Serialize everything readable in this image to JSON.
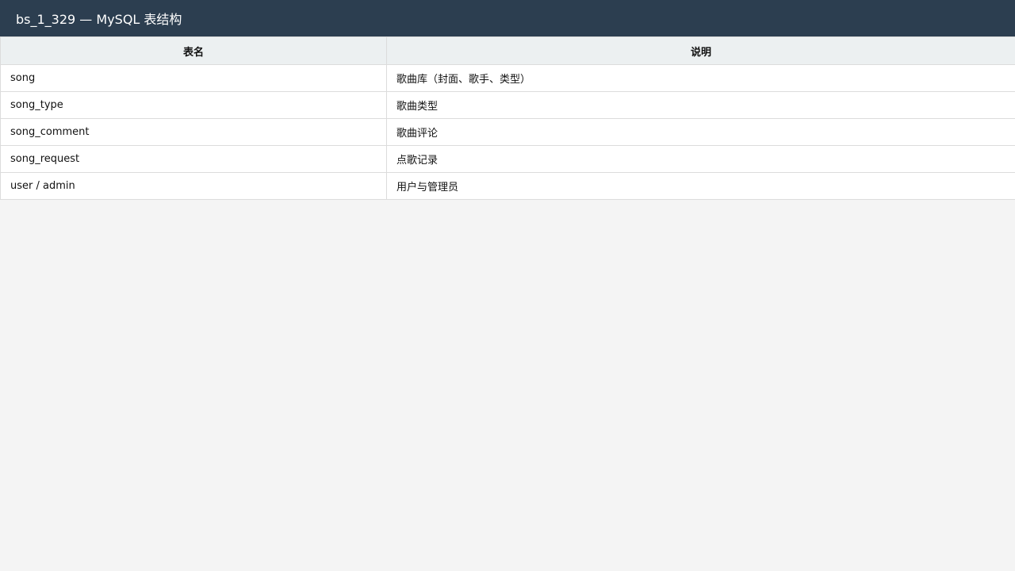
{
  "window": {
    "title": "bs_1_329 — MySQL 表结构"
  },
  "table": {
    "headers": [
      "表名",
      "说明"
    ],
    "rows": [
      [
        "song",
        "歌曲库（封面、歌手、类型）"
      ],
      [
        "song_type",
        "歌曲类型"
      ],
      [
        "song_comment",
        "歌曲评论"
      ],
      [
        "song_request",
        "点歌记录"
      ],
      [
        "user / admin",
        "用户与管理员"
      ]
    ]
  },
  "colors": {
    "titlebar_bg": "#2c3e50",
    "header_bg": "#ecf0f1",
    "page_bg": "#f4f4f4",
    "border": "#dcdcdc"
  }
}
